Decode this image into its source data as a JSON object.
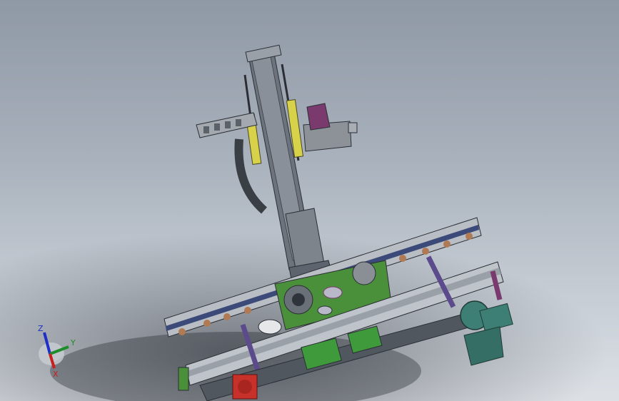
{
  "view": {
    "background_top": "#8f99a5",
    "background_bottom": "#dde1e6"
  },
  "model_colors": {
    "frame": "#5a626c",
    "rail_light": "#b9bec4",
    "rail_blue": "#3b4a78",
    "cylinder": "#d8d24a",
    "plate_green": "#4a8f3a",
    "motor_teal": "#3d7f74",
    "gearbox_red": "#c8302a",
    "brace_purple": "#5b4a8c",
    "accent_magenta": "#7a3a6e"
  },
  "triad": {
    "z_label": "Z",
    "y_label": "Y",
    "x_label": "X",
    "z_color": "#1f2fc8",
    "y_color": "#1e8c2a",
    "x_color": "#c81f1f"
  }
}
